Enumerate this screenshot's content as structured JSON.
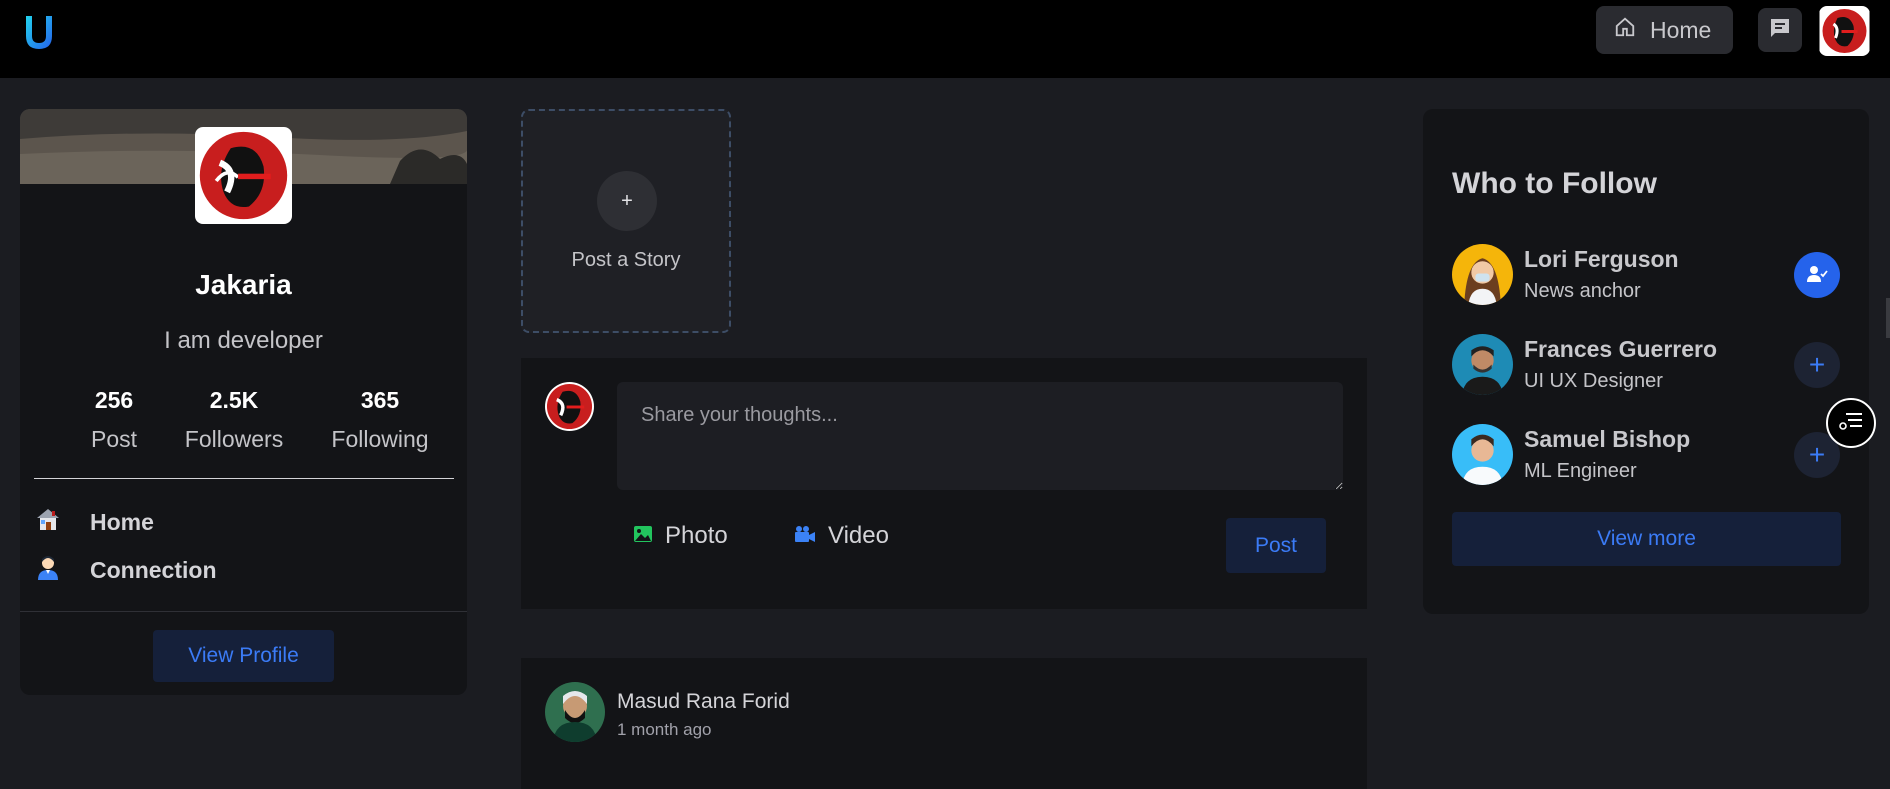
{
  "nav": {
    "logo": "logo-icon",
    "home_label": "Home",
    "home_icon": "home-icon",
    "message_icon": "message-icon"
  },
  "profile": {
    "name": "Jakaria",
    "bio": "I am developer",
    "stats": [
      {
        "value": "256",
        "label": "Post"
      },
      {
        "value": "2.5K",
        "label": "Followers"
      },
      {
        "value": "365",
        "label": "Following"
      }
    ],
    "menu": [
      {
        "label": "Home",
        "icon": "house-icon"
      },
      {
        "label": "Connection",
        "icon": "person-icon"
      }
    ],
    "view_profile": "View Profile"
  },
  "story": {
    "plus": "+",
    "label": "Post a Story"
  },
  "composer": {
    "placeholder": "Share your thoughts...",
    "photo_label": "Photo",
    "video_label": "Video",
    "post_label": "Post"
  },
  "feed": {
    "author": "Masud Rana Forid",
    "time": "1 month ago"
  },
  "follow": {
    "title": "Who to Follow",
    "people": [
      {
        "name": "Lori Ferguson",
        "role": "News anchor",
        "action": "followed"
      },
      {
        "name": "Frances Guerrero",
        "role": "UI UX Designer",
        "action": "add"
      },
      {
        "name": "Samuel Bishop",
        "role": "ML Engineer",
        "action": "add"
      }
    ],
    "add_symbol": "+",
    "view_more": "View more"
  },
  "colors": {
    "accent": "#3b7bf6",
    "background": "#1b1c21",
    "card": "#131417"
  }
}
